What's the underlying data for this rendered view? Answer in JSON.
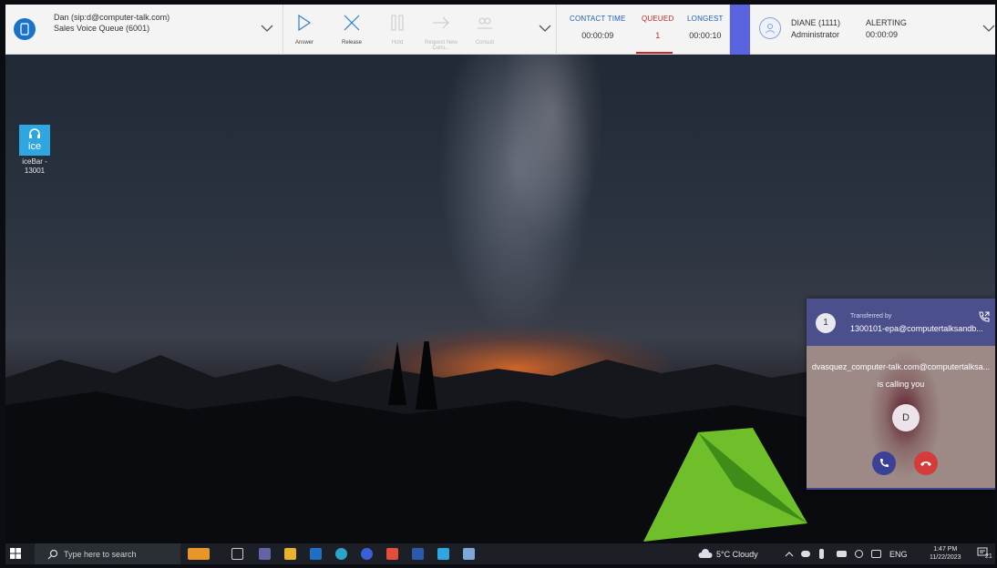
{
  "agent": {
    "name": "Dan (sip:d@computer-talk.com)",
    "queue": "Sales Voice Queue (6001)"
  },
  "actions": [
    {
      "label": "Answer",
      "icon": "play-icon",
      "enabled": true
    },
    {
      "label": "Release",
      "icon": "close-icon",
      "enabled": true
    },
    {
      "label": "Hold",
      "icon": "pause-icon",
      "enabled": false
    },
    {
      "label": "Request New Cons...",
      "icon": "arrow-right-icon",
      "enabled": false
    },
    {
      "label": "Consult",
      "icon": "consult-icon",
      "enabled": false
    }
  ],
  "stats": {
    "contact_time_label": "CONTACT TIME",
    "contact_time": "00:00:09",
    "queued_label": "QUEUED",
    "queued": "1",
    "longest_label": "LONGEST",
    "longest": "00:00:10"
  },
  "user": {
    "name": "DIANE (1111)",
    "role": "Administrator",
    "status": "ALERTING",
    "timer": "00:00:09"
  },
  "desktop_icon": {
    "label": "iceBar - 13001",
    "tile_text": "ice"
  },
  "toast": {
    "count": "1",
    "transferred_by_label": "Transferred by",
    "transferred_from": "1300101-epa@computertalksandb...",
    "caller": "dvasquez_computer-talk.com@computertalksa...",
    "calling_text": "is calling you",
    "initial": "D"
  },
  "taskbar": {
    "search_placeholder": "Type here to search",
    "weather": "5°C  Cloudy",
    "language": "ENG",
    "time": "1:47 PM",
    "date": "11/22/2023",
    "notification_count": "21"
  },
  "colors": {
    "accent": "#5a63e0",
    "toast_header": "#4b4f8c",
    "answer": "#3a4196",
    "decline": "#d43c3c",
    "queued": "#c62828",
    "stat_label": "#1a5fb4"
  }
}
